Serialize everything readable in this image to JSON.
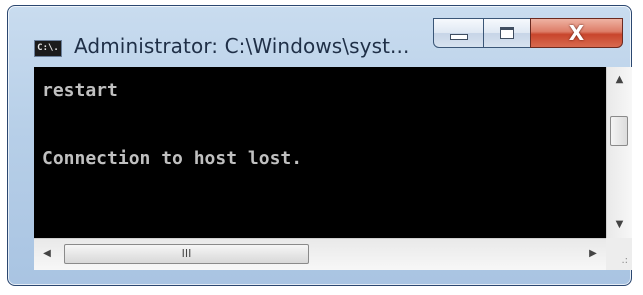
{
  "window": {
    "title": "Administrator: C:\\Windows\\syst...",
    "app_icon_text": "C:\\.",
    "controls": {
      "minimize": "minimize",
      "maximize": "maximize",
      "close": "X"
    }
  },
  "console": {
    "lines": [
      "restart",
      "",
      "Connection to host lost."
    ],
    "background": "#000000",
    "foreground": "#c0c0c0"
  },
  "scrollbars": {
    "vertical": {
      "up_arrow": "▲",
      "down_arrow": "▼"
    },
    "horizontal": {
      "left_arrow": "◀",
      "right_arrow": "▶",
      "thumb_grip": "III"
    },
    "size_grip": ".:"
  }
}
